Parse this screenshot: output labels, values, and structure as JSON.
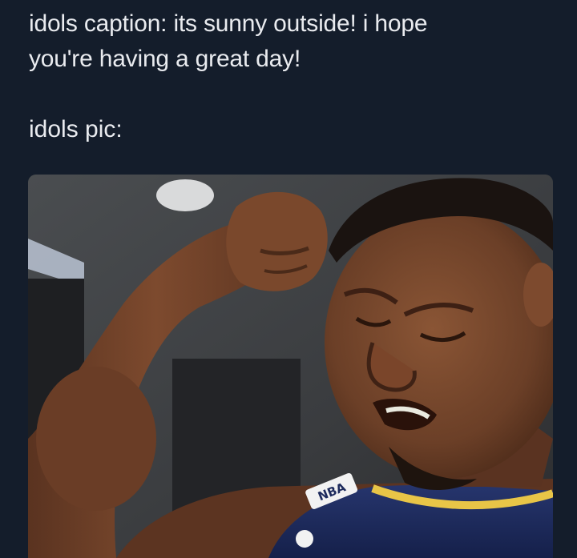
{
  "caption": {
    "line1": "idols caption: its sunny outside! i hope",
    "line2": "you're having a great day!"
  },
  "pic_label": "idols pic:",
  "photo": {
    "jersey_logo_text": "NBA"
  },
  "colors": {
    "background": "#141d2b",
    "text": "#e9ebef",
    "jersey": "#1d2a5c",
    "jersey_trim": "#e8c547",
    "skin": "#6b3f27"
  }
}
